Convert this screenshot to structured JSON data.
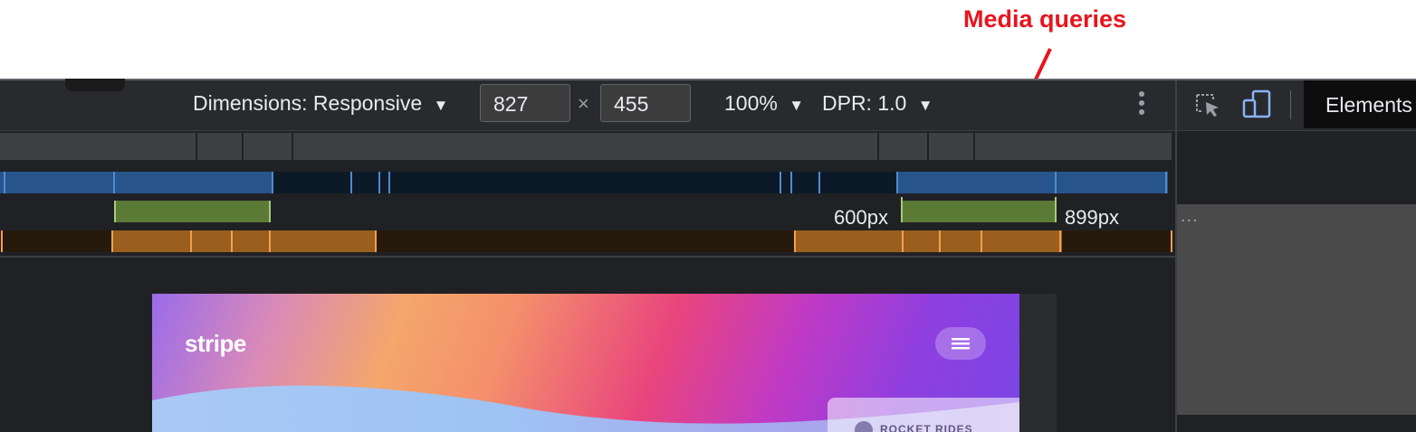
{
  "annotation": {
    "label": "Media queries"
  },
  "toolbar": {
    "dimensions_label": "Dimensions: Responsive",
    "dropdown_glyph": "▼",
    "width_value": "827",
    "times_glyph": "×",
    "height_value": "455",
    "zoom_label": "100%",
    "dpr_label": "DPR: 1.0"
  },
  "right_panel": {
    "elements_tab": "Elements",
    "ellipsis": "..."
  },
  "media_queries": {
    "min_label": "600px",
    "max_label": "899px"
  },
  "page": {
    "logo": "stripe",
    "card_text": "ROCKET RIDES"
  },
  "colors": {
    "annotation": "#e8141e",
    "devtools_bg": "#202124",
    "max_width_bar": "#27548a",
    "range_bar": "#5b7a35",
    "min_width_bar": "#9a5e1e"
  }
}
